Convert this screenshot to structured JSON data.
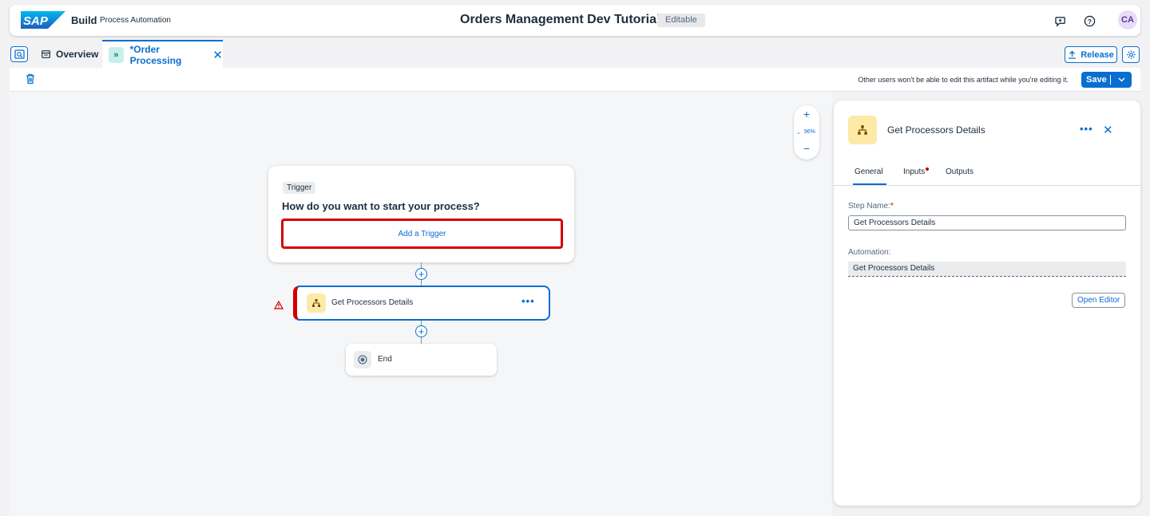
{
  "shell": {
    "logo_text": "SAP",
    "brand": "Build",
    "product": "Process Automation",
    "project_title": "Orders Management Dev Tutorial",
    "status_badge": "Editable",
    "avatar_initials": "CA",
    "icons": [
      "feedback-icon",
      "help-icon"
    ]
  },
  "tabs": {
    "overview_label": "Overview",
    "active_label": "*Order Processing",
    "release_label": "Release"
  },
  "toolbar": {
    "notice": "Other users won't be able to edit this artifact while you're editing it.",
    "save_label": "Save"
  },
  "canvas": {
    "zoom_level": "96%",
    "trigger": {
      "tag": "Trigger",
      "question": "How do you want to start your process?",
      "add_label": "Add a Trigger"
    },
    "step": {
      "label": "Get Processors Details"
    },
    "end_label": "End"
  },
  "panel": {
    "title": "Get Processors Details",
    "tabs": [
      "General",
      "Inputs",
      "Outputs"
    ],
    "active_tab": "General",
    "step_name_label": "Step Name:",
    "step_name_required": "*",
    "step_name_value": "Get Processors Details",
    "automation_label": "Automation:",
    "automation_value": "Get Processors Details",
    "open_editor_label": "Open Editor"
  },
  "colors": {
    "accent": "#0a6ed1",
    "error": "#d40000",
    "automation_icon_bg": "#fdeaa6"
  }
}
